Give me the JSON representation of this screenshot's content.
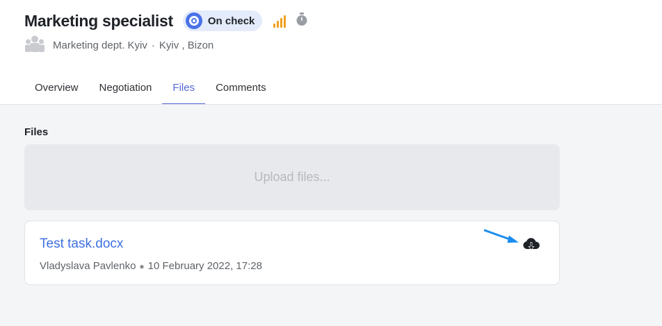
{
  "header": {
    "title": "Marketing specialist",
    "status": {
      "label": "On check",
      "color": "#4a72e8"
    },
    "priority_icon": "signal-bars-icon",
    "timer_icon": "stopwatch-icon",
    "subtitle": {
      "department": "Marketing dept. Kyiv",
      "location": "Kyiv , Bizon"
    }
  },
  "tabs": [
    {
      "label": "Overview",
      "active": false
    },
    {
      "label": "Negotiation",
      "active": false
    },
    {
      "label": "Files",
      "active": true
    },
    {
      "label": "Comments",
      "active": false
    }
  ],
  "files_section": {
    "heading": "Files",
    "upload_placeholder": "Upload files...",
    "items": [
      {
        "name": "Test task.docx",
        "author": "Vladyslava Pavlenko",
        "date": "10 February 2022, 17:28",
        "action_icon": "cloud-download-icon"
      }
    ]
  },
  "colors": {
    "accent": "#5468d4",
    "link": "#3d6fe0",
    "priority": "#f0a020",
    "annotation_arrow": "#1a8cf0"
  }
}
